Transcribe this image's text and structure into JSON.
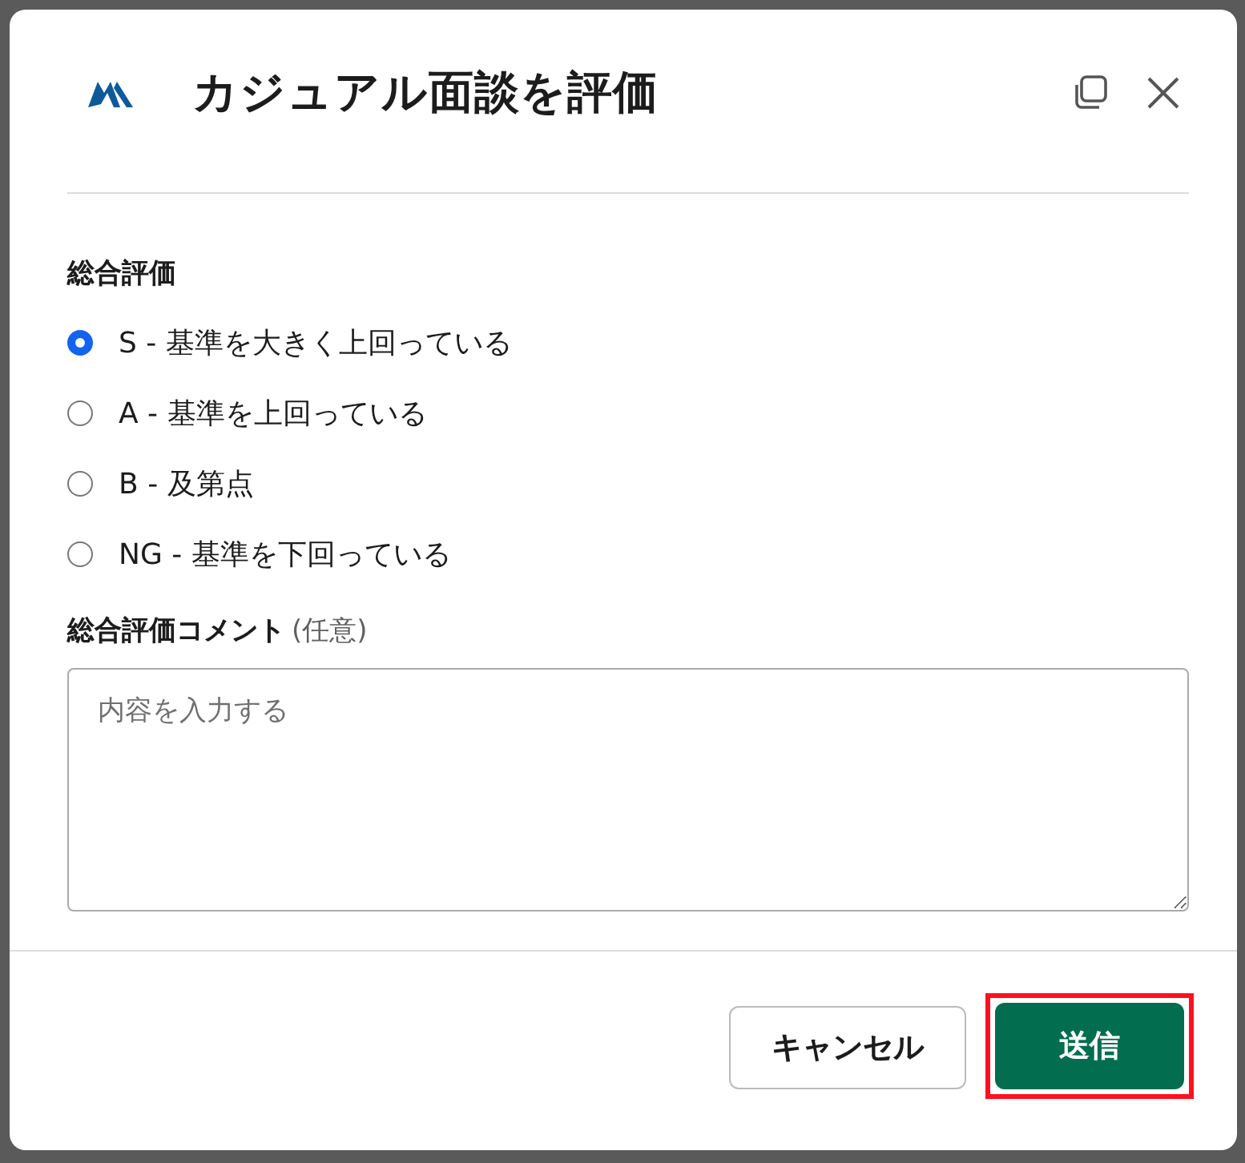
{
  "dialog": {
    "title": "カジュアル面談を評価"
  },
  "rating": {
    "label": "総合評価",
    "options": [
      {
        "label": "S - 基準を大きく上回っている",
        "selected": true
      },
      {
        "label": "A - 基準を上回っている",
        "selected": false
      },
      {
        "label": "B - 及第点",
        "selected": false
      },
      {
        "label": "NG - 基準を下回っている",
        "selected": false
      }
    ]
  },
  "comment": {
    "label": "総合評価コメント",
    "optional": "(任意)",
    "placeholder": "内容を入力する"
  },
  "buttons": [
    {
      "label": "キャンセル",
      "kind": "secondary",
      "highlighted": false
    },
    {
      "label": "送信",
      "kind": "primary",
      "highlighted": true
    }
  ]
}
